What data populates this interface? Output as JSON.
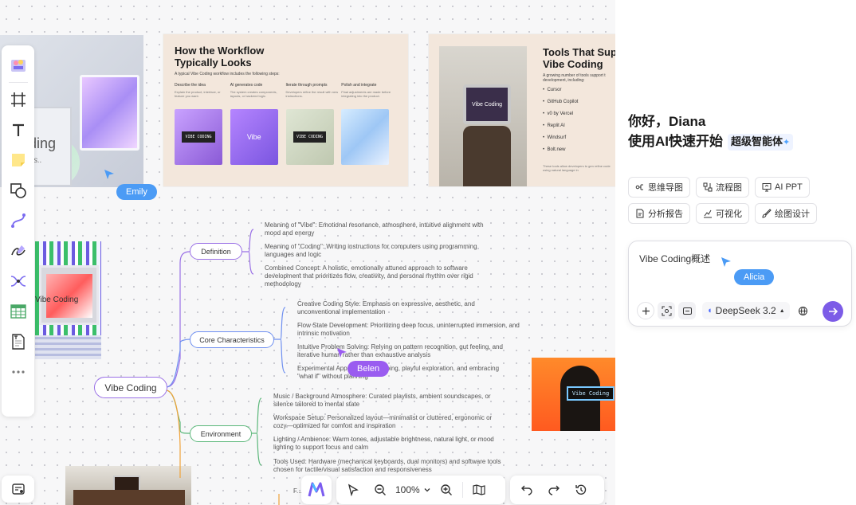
{
  "mindmap": {
    "root": "Vibe Coding",
    "branches": [
      {
        "label": "Definition",
        "leaves": [
          "Meaning of \"Vibe\": Emotional resonance, atmosphere, intuitive alignment with mood and energy",
          "Meaning of \"Coding\": Writing instructions for computers using programming languages and logic",
          "Combined Concept: A holistic, emotionally attuned approach to software development that prioritizes flow, creativity, and personal rhythm over rigid methodology"
        ]
      },
      {
        "label": "Core Characteristics",
        "leaves": [
          "Creative Coding Style: Emphasis on expressive, aesthetic, and unconventional implementation",
          "Flow State Development: Prioritizing deep focus, uninterrupted immersion, and intrinsic motivation",
          "Intuitive Problem Solving: Relying on pattern recognition, gut feeling, and iterative human rather than exhaustive analysis",
          "Experimental Approach: prototyping, playful exploration, and embracing \"what if\" without planning"
        ]
      },
      {
        "label": "Environment",
        "leaves": [
          "Music / Background Atmosphere: Curated playlists, ambient soundscapes, or silence tailored to mental state",
          "Workspace Setup: Personalized layout—minimalist or cluttered, ergonomic or cozy—optimized for comfort and inspiration",
          "Lighting / Ambience: Warm tones, adjustable brightness, natural light, or mood lighting to support focus and calm",
          "Tools Used: Hardware (mechanical keyboards, dual monitors) and software tools chosen for tactile/visual satisfaction and responsiveness"
        ]
      }
    ],
    "partial_leaf": "F... c..."
  },
  "slides": {
    "workflow": {
      "title_line1": "How the Workflow",
      "title_line2": "Typically Looks",
      "subtitle": "A typical Vibe Coding workflow includes the following steps:",
      "steps": [
        {
          "title": "Describe the idea",
          "desc": "Explain the product, interface, or feature you want."
        },
        {
          "title": "AI generates code",
          "desc": "The system creates components, layouts, or backend logic."
        },
        {
          "title": "Iterate through prompts",
          "desc": "Developers refine the result with new instructions."
        },
        {
          "title": "Polish and integrate",
          "desc": "Final adjustments are made before integrating into the product."
        }
      ],
      "thumb_labels": [
        "VIBE CODING",
        "Vibe",
        "VIBE CODING"
      ]
    },
    "tools": {
      "title_line1": "Tools That Sup",
      "title_line2": "Vibe Coding",
      "subtitle": "A growing number of tools support t development, including:",
      "items": [
        "Cursor",
        "GitHub Copilot",
        "v0 by Vercel",
        "Replit AI",
        "Windsurf",
        "Bolt.new"
      ],
      "footer": "These tools allow developers to gen refine code using natural language in",
      "image_label": "Vibe Coding"
    }
  },
  "canvas_images": {
    "left_top_text": "ding",
    "left_top_sub": "'ls..",
    "left_mid_text": "Vibe Coding",
    "right_label": "Vibe Coding"
  },
  "cursors": [
    {
      "name": "Emily",
      "color": "#4b9bf5"
    },
    {
      "name": "Belen",
      "color": "#9a5cf0"
    },
    {
      "name": "Alicia",
      "color": "#4b9bf5"
    }
  ],
  "toolbar": {
    "zoom": "100%"
  },
  "panel": {
    "greeting_line1": "你好，Diana",
    "greeting_line2": "使用AI快速开始",
    "agent_badge": "超级智能体",
    "chips": [
      "思维导图",
      "流程图",
      "AI PPT",
      "分析报告",
      "可视化",
      "绘图设计"
    ],
    "input_value": "Vibe Coding概述",
    "model": "DeepSeek 3.2",
    "accent": "#7c5ce7"
  }
}
